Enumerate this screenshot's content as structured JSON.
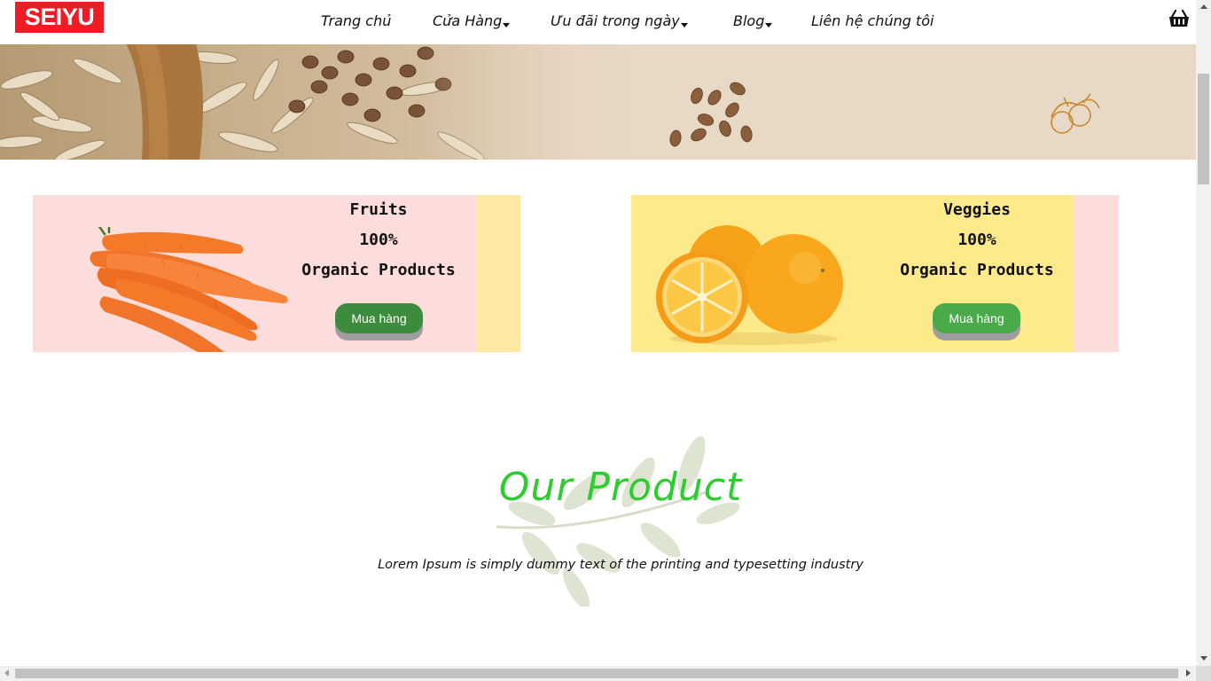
{
  "header": {
    "logo_text": "SEIYU",
    "nav": [
      {
        "label": "Trang chủ",
        "has_dropdown": false
      },
      {
        "label": "Cửa Hàng",
        "has_dropdown": true
      },
      {
        "label": "Ưu đãi trong ngày",
        "has_dropdown": true
      },
      {
        "label": "Blog",
        "has_dropdown": true
      },
      {
        "label": "Liên hệ chúng tôi",
        "has_dropdown": false
      }
    ],
    "cart_icon": "basket-icon"
  },
  "promos": [
    {
      "line1": "Fruits",
      "line2": "100%",
      "line3": "Organic Products",
      "button": "Mua hàng",
      "image": "carrots-image"
    },
    {
      "line1": "Veggies",
      "line2": "100%",
      "line3": "Organic Products",
      "button": "Mua hàng",
      "image": "oranges-image"
    }
  ],
  "section": {
    "title": "Our Product",
    "subtitle": "Lorem Ipsum is simply dummy text of the printing and typesetting industry"
  },
  "colors": {
    "logo_bg": "#ee1c25",
    "title_green": "#2ecc2e",
    "button_green": "#3d8b3d",
    "pink": "#fddddb",
    "yellow": "#fdea8a"
  }
}
